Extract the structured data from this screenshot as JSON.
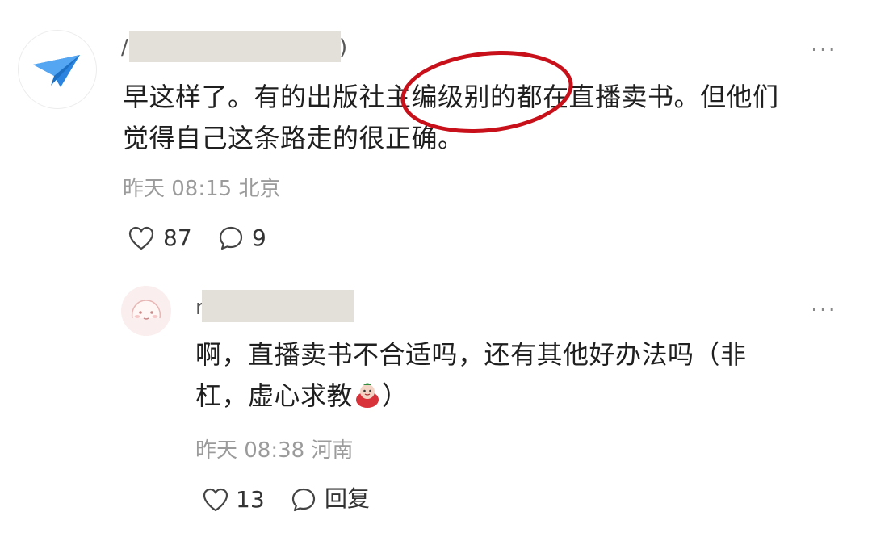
{
  "comment": {
    "username_visible_start": "/",
    "username_visible_end": ")",
    "text_line1": "早这样了。有的出版社主编级别的都在直播卖书。但他们",
    "text_line2": "觉得自己这条路走的很正确。",
    "time": "昨天 08:15 北京",
    "likes": "87",
    "replies": "9",
    "more": "···",
    "avatar_icon": "paper-plane-icon"
  },
  "reply": {
    "username_visible_start": "r",
    "text_line1": "啊，直播卖书不合适吗，还有其他好办法吗（非",
    "text_line2_before": "杠，虚心求教",
    "text_line2_after": "）",
    "emoji": "red-round-character-emoji",
    "time": "昨天 08:38 河南",
    "likes": "13",
    "reply_label": "回复",
    "more": "···"
  },
  "annotation": {
    "color": "#c8101a",
    "shape": "ellipse"
  }
}
